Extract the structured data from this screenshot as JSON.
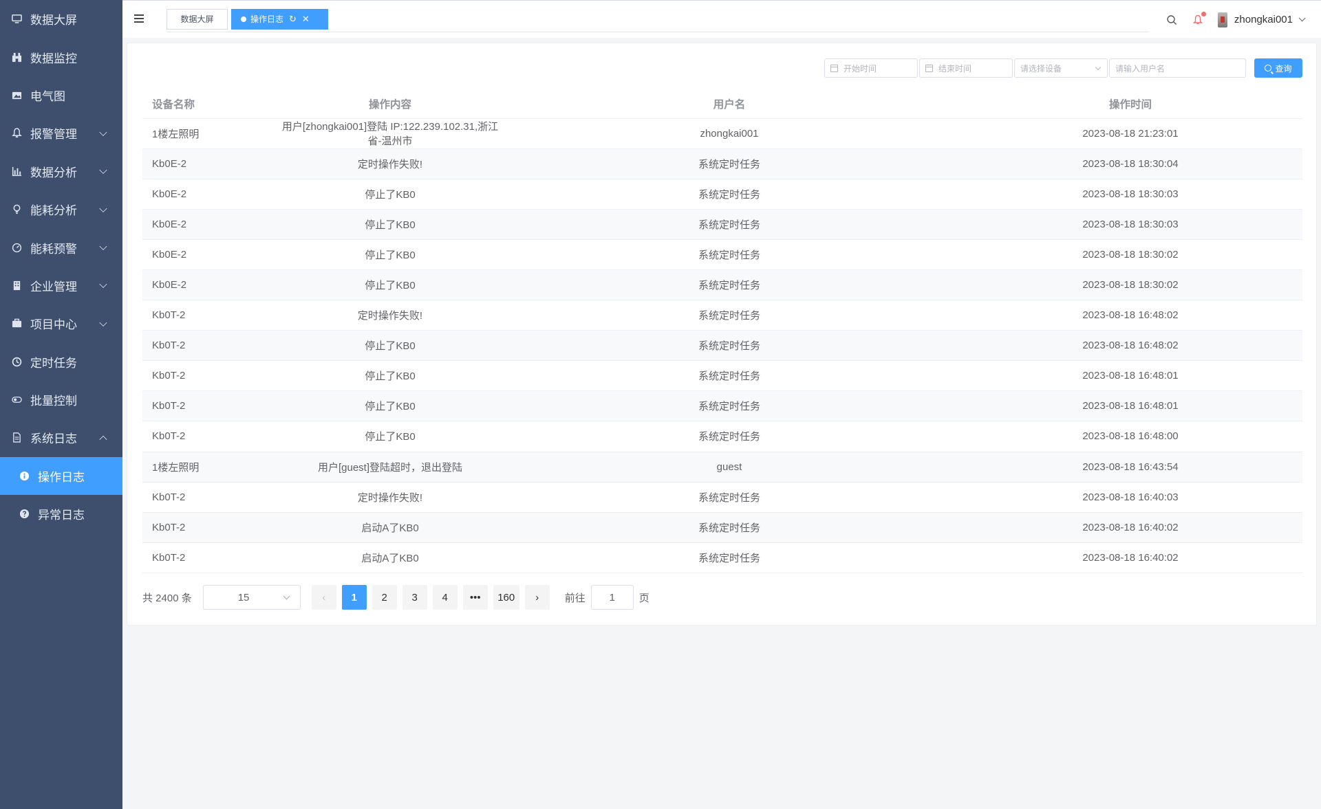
{
  "sidebar": {
    "items": [
      {
        "label": "数据大屏",
        "icon": "monitor-icon"
      },
      {
        "label": "数据监控",
        "icon": "binoculars-icon"
      },
      {
        "label": "电气图",
        "icon": "image-icon"
      },
      {
        "label": "报警管理",
        "icon": "bell-icon"
      },
      {
        "label": "数据分析",
        "icon": "bar-chart-icon"
      },
      {
        "label": "能耗分析",
        "icon": "bulb-icon"
      },
      {
        "label": "能耗预警",
        "icon": "dashboard-icon"
      },
      {
        "label": "企业管理",
        "icon": "building-icon"
      },
      {
        "label": "项目中心",
        "icon": "briefcase-icon"
      },
      {
        "label": "定时任务",
        "icon": "clock-icon"
      },
      {
        "label": "批量控制",
        "icon": "toggle-icon"
      },
      {
        "label": "系统日志",
        "icon": "document-icon"
      },
      {
        "label": "操作日志",
        "icon": "info-icon"
      },
      {
        "label": "异常日志",
        "icon": "question-icon"
      }
    ]
  },
  "header": {
    "tabs": [
      {
        "label": "数据大屏"
      },
      {
        "label": "操作日志"
      }
    ],
    "username": "zhongkai001"
  },
  "filters": {
    "start_placeholder": "开始时间",
    "end_placeholder": "结束时间",
    "device_placeholder": "请选择设备",
    "user_placeholder": "请输入用户名",
    "query_label": "查询"
  },
  "table": {
    "headers": [
      "设备名称",
      "操作内容",
      "用户名",
      "操作时间"
    ],
    "rows": [
      [
        "1楼左照明",
        "用户[zhongkai001]登陆 IP:122.239.102.31,浙江省-温州市",
        "zhongkai001",
        "2023-08-18 21:23:01"
      ],
      [
        "Kb0E-2",
        "定时操作失败!",
        "系统定时任务",
        "2023-08-18 18:30:04"
      ],
      [
        "Kb0E-2",
        "停止了KB0",
        "系统定时任务",
        "2023-08-18 18:30:03"
      ],
      [
        "Kb0E-2",
        "停止了KB0",
        "系统定时任务",
        "2023-08-18 18:30:03"
      ],
      [
        "Kb0E-2",
        "停止了KB0",
        "系统定时任务",
        "2023-08-18 18:30:02"
      ],
      [
        "Kb0E-2",
        "停止了KB0",
        "系统定时任务",
        "2023-08-18 18:30:02"
      ],
      [
        "Kb0T-2",
        "定时操作失败!",
        "系统定时任务",
        "2023-08-18 16:48:02"
      ],
      [
        "Kb0T-2",
        "停止了KB0",
        "系统定时任务",
        "2023-08-18 16:48:02"
      ],
      [
        "Kb0T-2",
        "停止了KB0",
        "系统定时任务",
        "2023-08-18 16:48:01"
      ],
      [
        "Kb0T-2",
        "停止了KB0",
        "系统定时任务",
        "2023-08-18 16:48:01"
      ],
      [
        "Kb0T-2",
        "停止了KB0",
        "系统定时任务",
        "2023-08-18 16:48:00"
      ],
      [
        "1楼左照明",
        "用户[guest]登陆超时，退出登陆",
        "guest",
        "2023-08-18 16:43:54"
      ],
      [
        "Kb0T-2",
        "定时操作失败!",
        "系统定时任务",
        "2023-08-18 16:40:03"
      ],
      [
        "Kb0T-2",
        "启动A了KB0",
        "系统定时任务",
        "2023-08-18 16:40:02"
      ],
      [
        "Kb0T-2",
        "启动A了KB0",
        "系统定时任务",
        "2023-08-18 16:40:02"
      ]
    ]
  },
  "pagination": {
    "total_label": "共 2400 条",
    "page_size": "15",
    "prev": "‹",
    "next": "›",
    "pages": [
      "1",
      "2",
      "3",
      "4",
      "•••",
      "160"
    ],
    "current": "1",
    "goto_label": "前往",
    "goto_value": "1",
    "page_unit": "页"
  },
  "colors": {
    "sidebar_bg": "#3e4f6e",
    "accent": "#409eff",
    "badge": "#f56c6c"
  }
}
